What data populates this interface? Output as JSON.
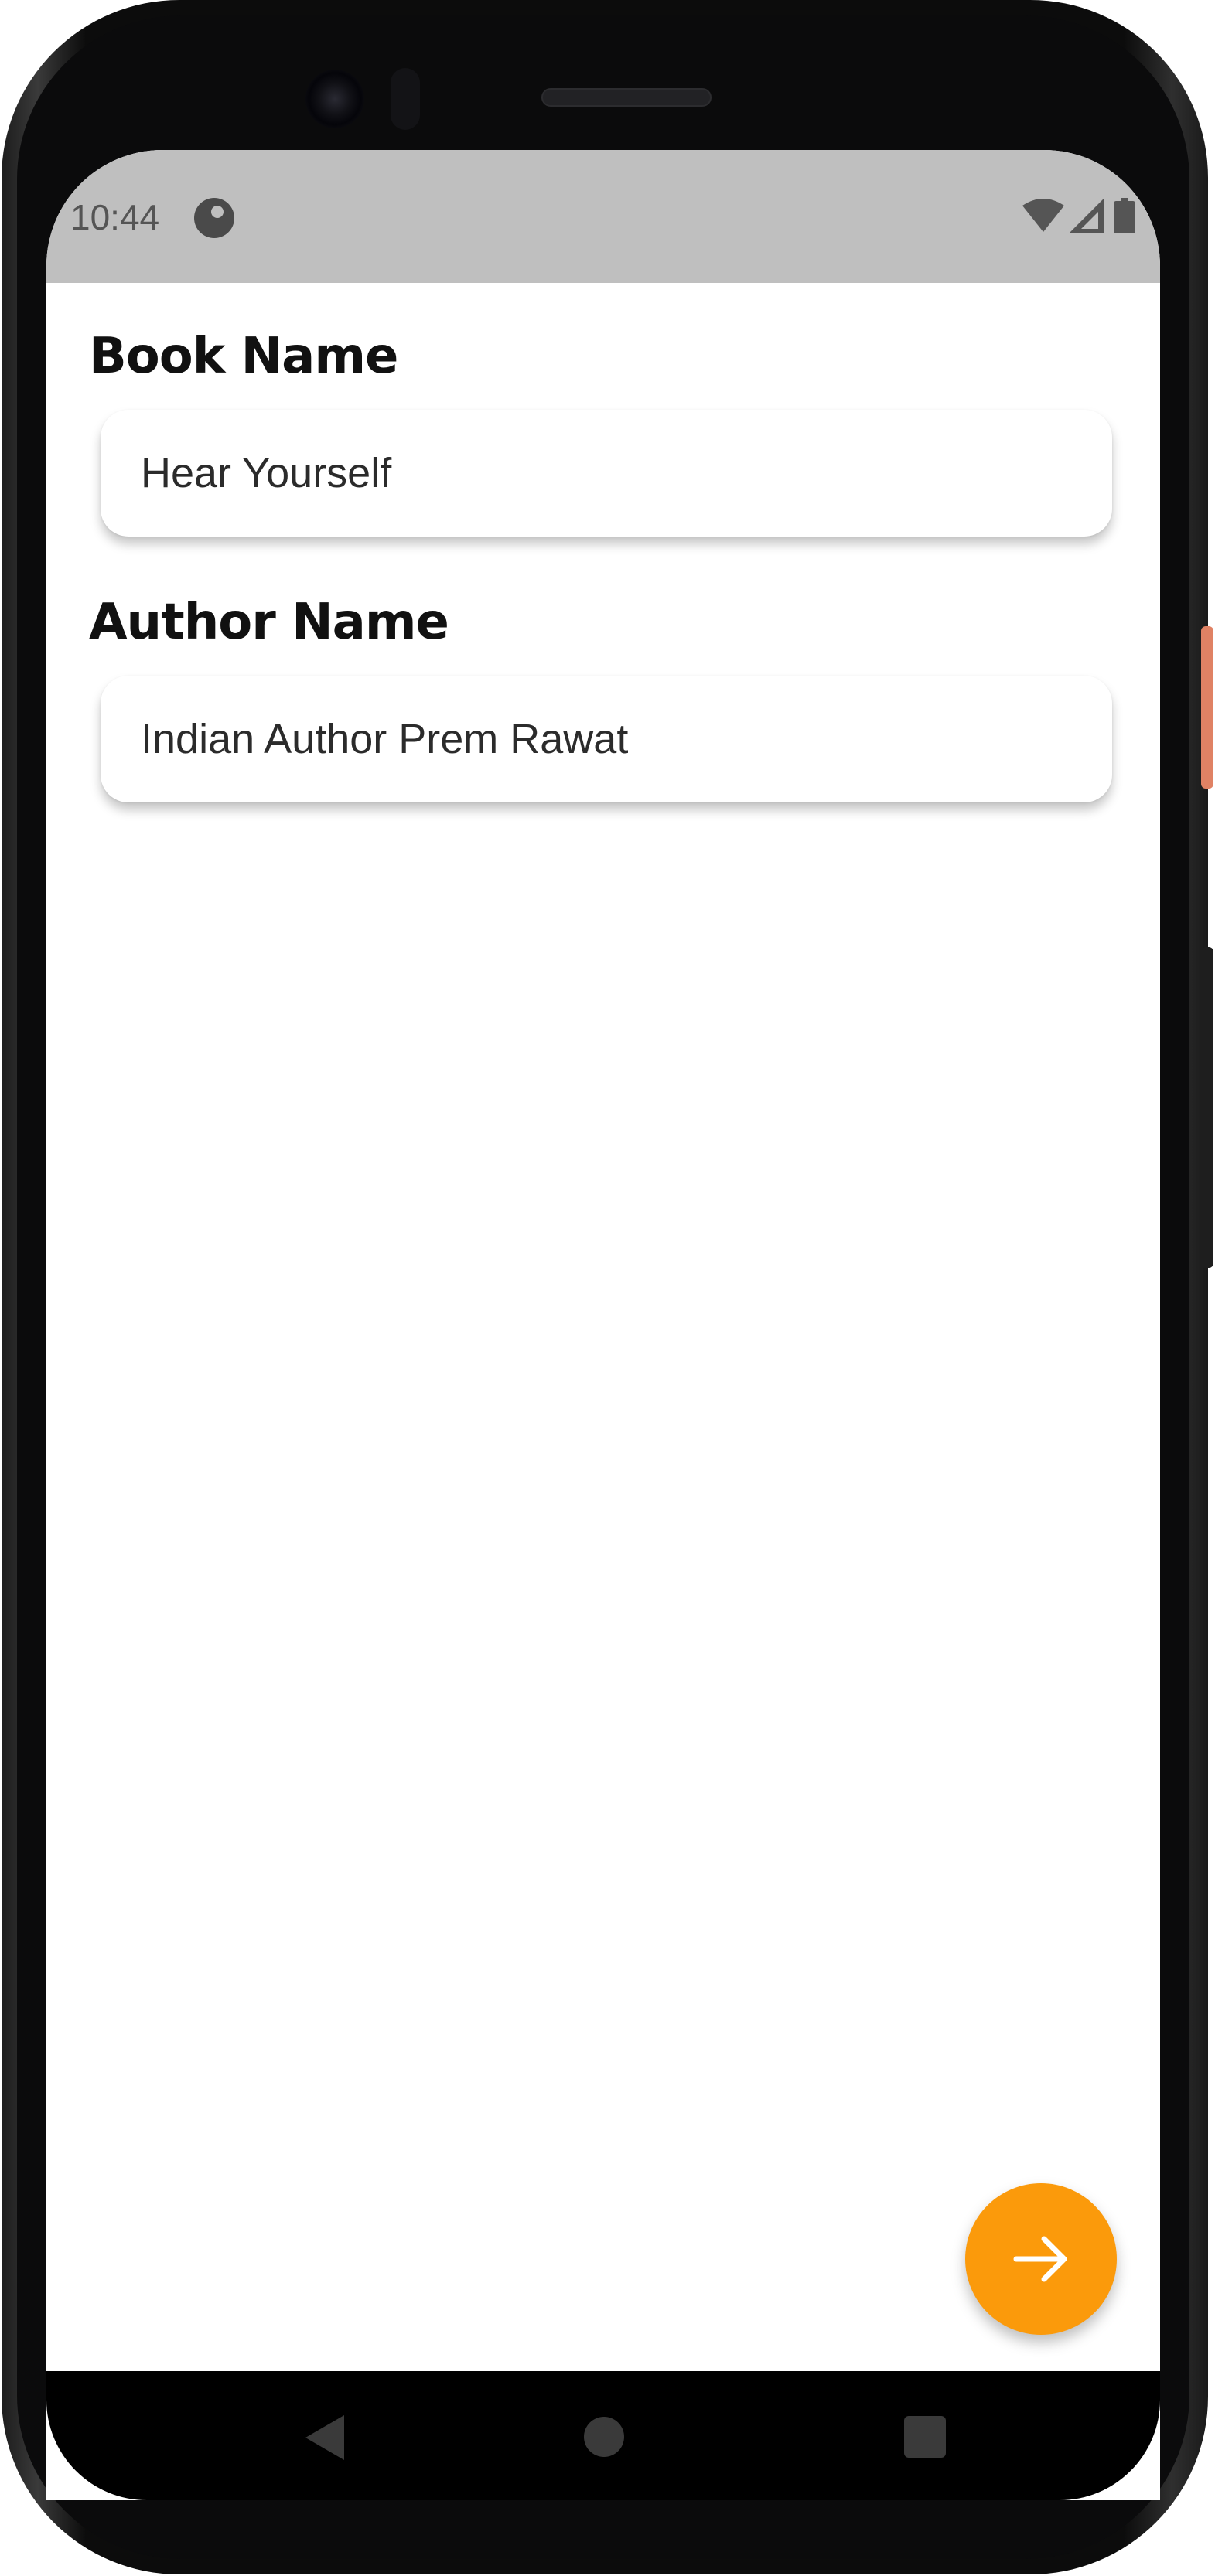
{
  "status_bar": {
    "time": "10:44",
    "icons": [
      "app-notification-icon",
      "wifi-icon",
      "signal-icon",
      "battery-icon"
    ]
  },
  "form": {
    "book_name_label": "Book Name",
    "book_name_value": "Hear Yourself",
    "author_name_label": "Author Name",
    "author_name_value": "Indian Author Prem Rawat"
  },
  "fab": {
    "icon": "arrow-right-icon",
    "color": "#fb9a0b"
  },
  "nav_bar": {
    "icons": [
      "back-icon",
      "home-icon",
      "recents-icon"
    ]
  },
  "colors": {
    "status_bar": "#bfbfbf",
    "accent": "#fb9a0b",
    "background": "#ffffff"
  }
}
